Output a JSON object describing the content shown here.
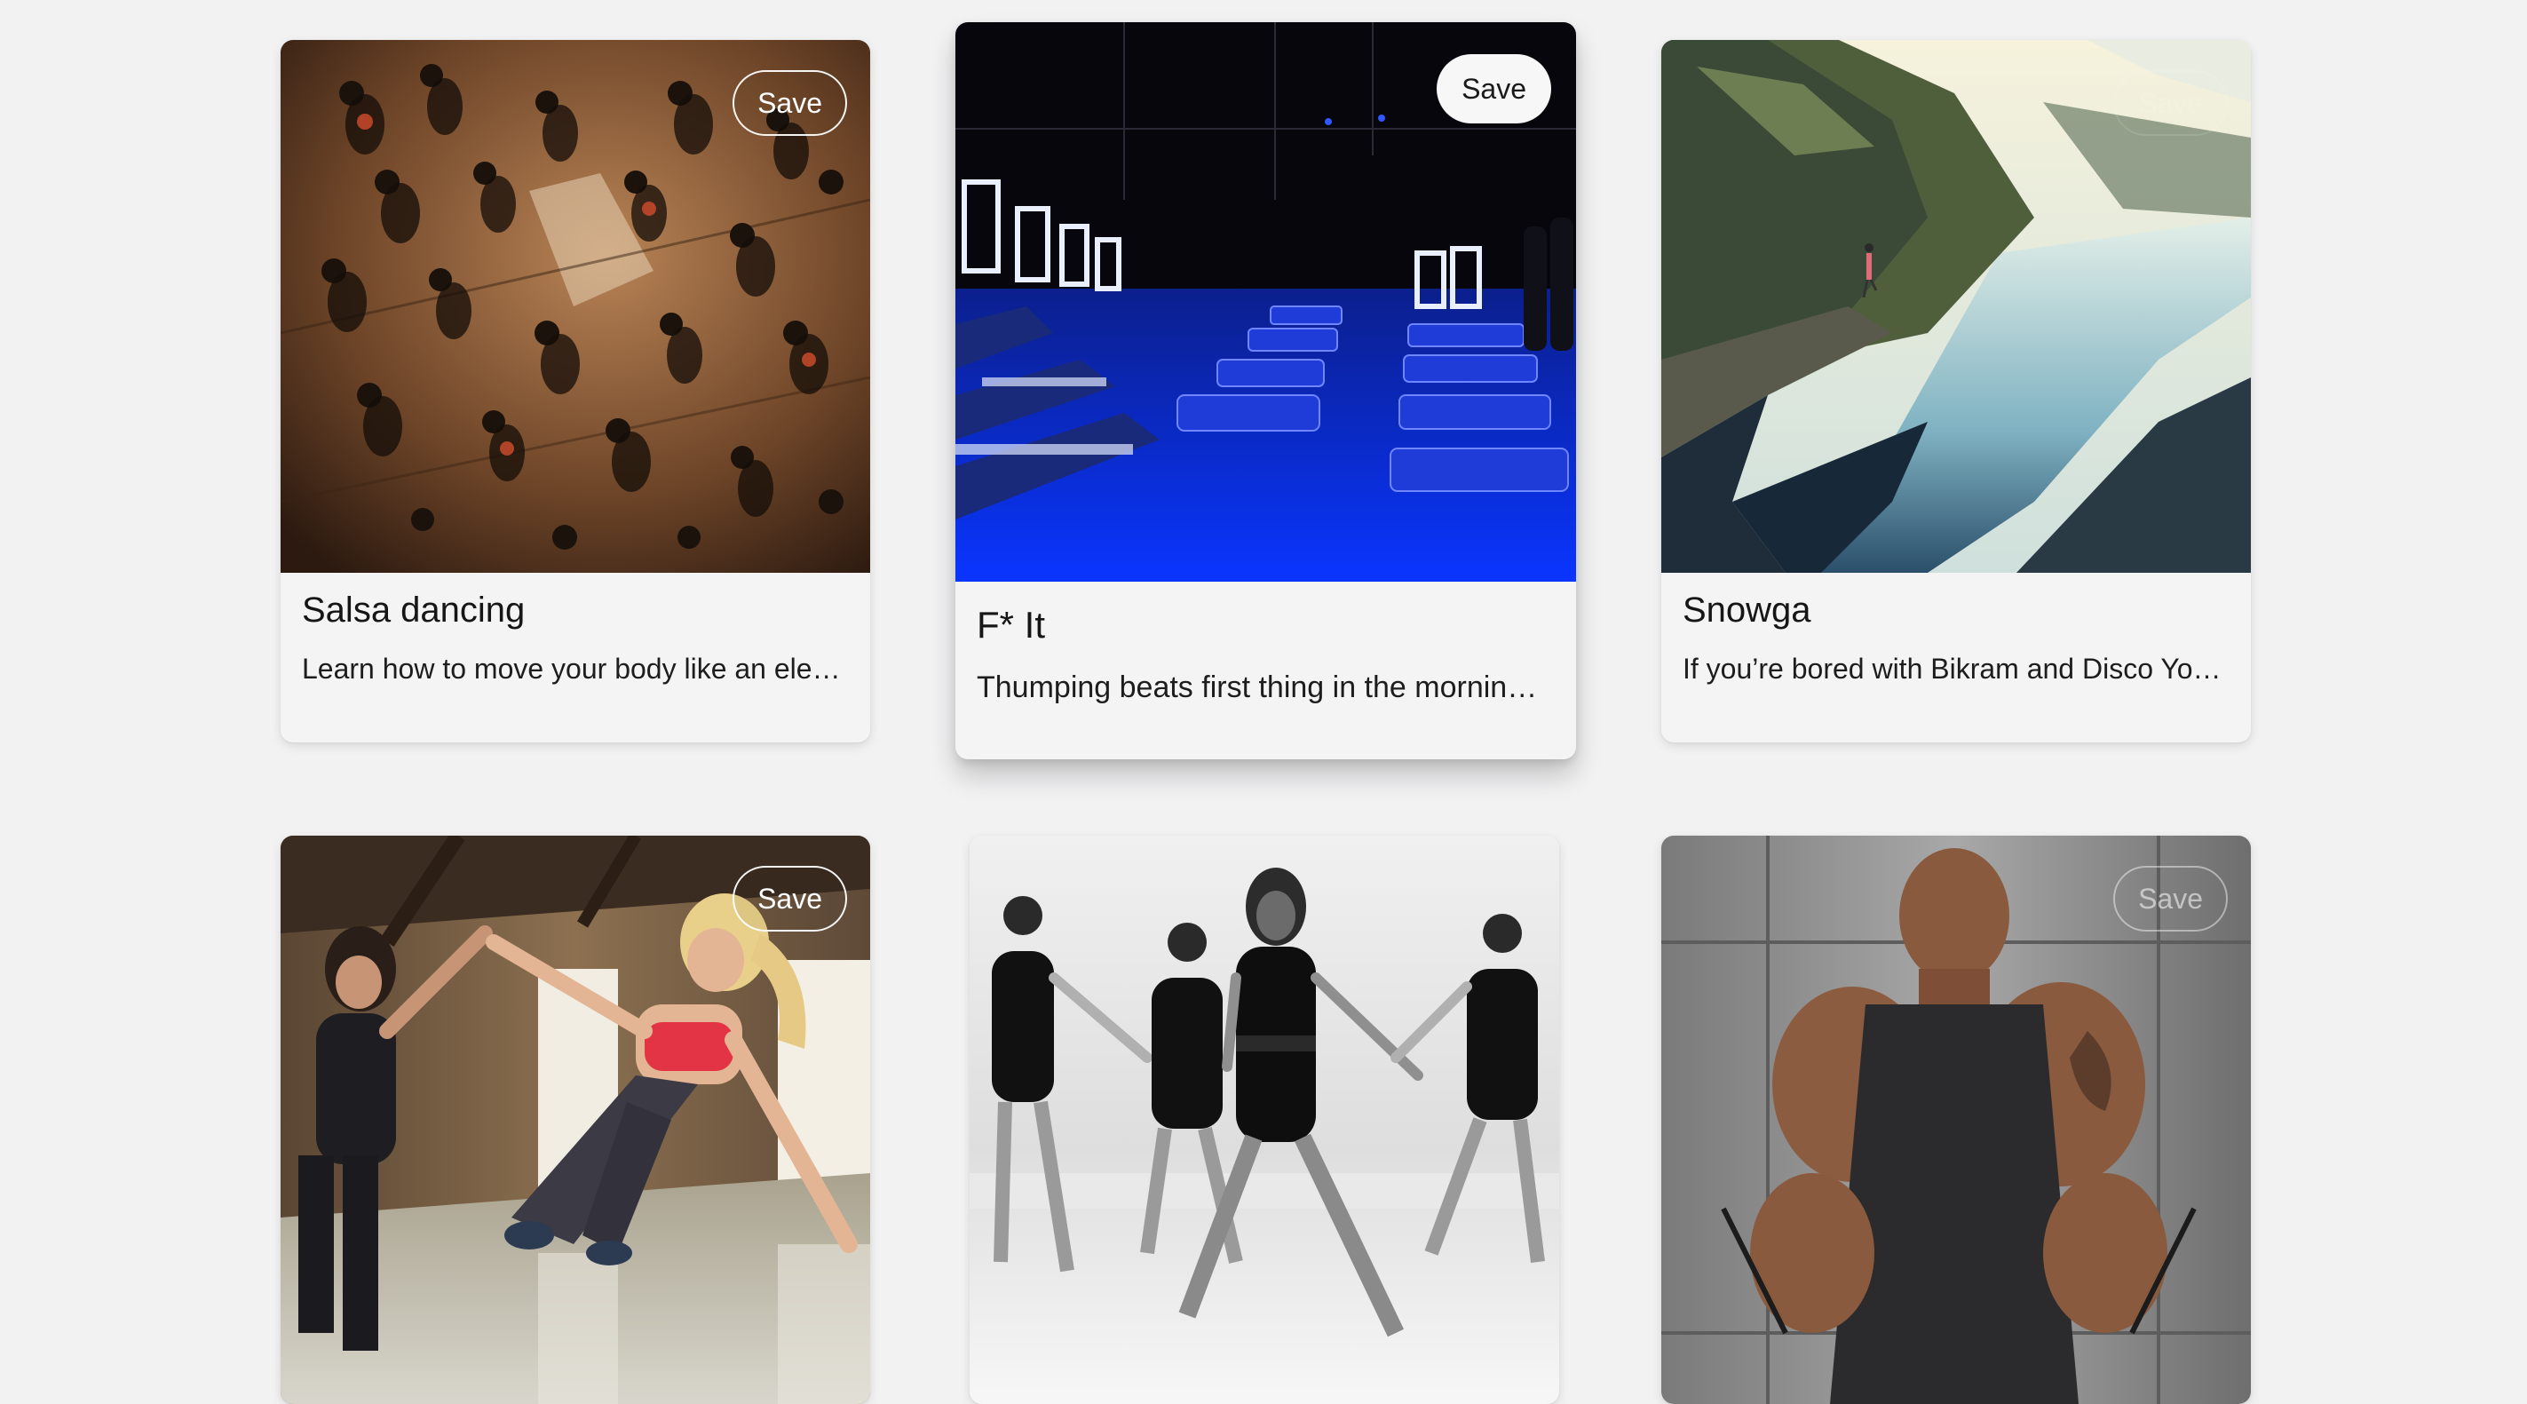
{
  "cards": [
    {
      "title": "Salsa dancing",
      "description": "Learn how to move your body like an ele…",
      "save_label": "Save",
      "image_subject": "salsa-dancers-floor",
      "state": "normal"
    },
    {
      "title": "F* It",
      "description": "Thumping beats first thing in the mornin…",
      "save_label": "Save",
      "image_subject": "blue-lit-gym",
      "state": "hovered"
    },
    {
      "title": "Snowga",
      "description": "If you’re bored with Bikram and Disco Yo…",
      "save_label": "Save",
      "image_subject": "mountain-fjord-yoga",
      "state": "normal"
    },
    {
      "title": "",
      "description": "",
      "save_label": "Save",
      "image_subject": "women-high-five-workout",
      "state": "normal"
    },
    {
      "title": "",
      "description": "",
      "save_label": "",
      "image_subject": "dancers-black-leotards",
      "state": "normal"
    },
    {
      "title": "",
      "description": "",
      "save_label": "Save",
      "image_subject": "muscular-man-gym",
      "state": "normal"
    }
  ],
  "colors": {
    "page_background": "#f2f2f3",
    "card_background": "#f4f4f5",
    "gym_blue": "#0a2cff"
  }
}
